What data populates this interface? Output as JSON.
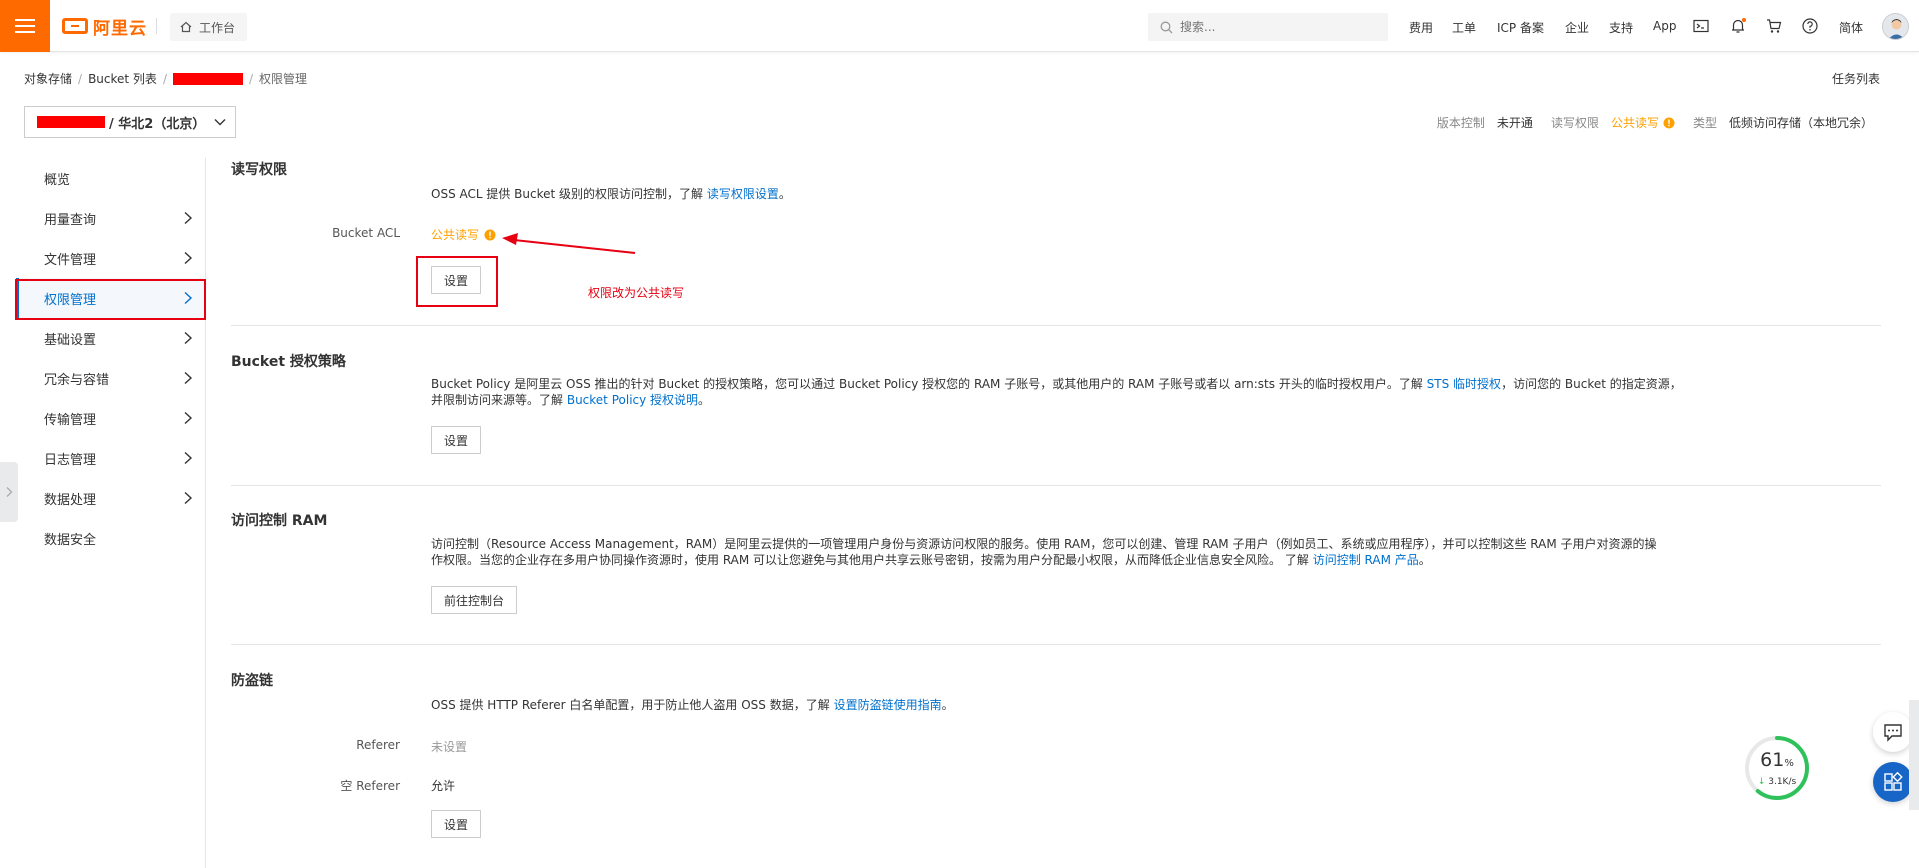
{
  "topbar": {
    "logo_text": "阿里云",
    "workbench_label": "工作台",
    "search_placeholder": "搜索...",
    "nav": [
      "费用",
      "工单",
      "ICP 备案",
      "企业",
      "支持",
      "App"
    ],
    "lang_label": "简体",
    "icons": [
      "terminal-icon",
      "bell-icon",
      "cart-icon",
      "help-icon"
    ]
  },
  "breadcrumb": {
    "items": [
      "对象存储",
      "Bucket 列表"
    ],
    "current": "权限管理"
  },
  "task_list_label": "任务列表",
  "bucket_selector": {
    "label": "/ 华北2（北京）"
  },
  "bucket_info": {
    "version_key": "版本控制",
    "version_value": "未开通",
    "acl_key": "读写权限",
    "acl_value": "公共读写",
    "type_key": "类型",
    "type_value": "低频访问存储（本地冗余）"
  },
  "sidebar": {
    "items": [
      {
        "label": "概览"
      },
      {
        "label": "用量查询"
      },
      {
        "label": "文件管理"
      },
      {
        "label": "权限管理"
      },
      {
        "label": "基础设置"
      },
      {
        "label": "冗余与容错"
      },
      {
        "label": "传输管理"
      },
      {
        "label": "日志管理"
      },
      {
        "label": "数据处理"
      },
      {
        "label": "数据安全"
      }
    ]
  },
  "sections": {
    "acl": {
      "title": "读写权限",
      "desc_prefix": "OSS ACL 提供 Bucket 级别的权限访问控制，了解",
      "desc_link": "读写权限设置",
      "desc_suffix": "。",
      "field_label": "Bucket ACL",
      "field_value": "公共读写",
      "button": "设置"
    },
    "policy": {
      "title": "Bucket 授权策略",
      "line1_prefix": "Bucket Policy 是阿里云 OSS 推出的针对 Bucket 的授权策略，您可以通过 Bucket Policy 授权您的 RAM 子账号，或其他用户的 RAM 子账号或者以 arn:sts 开头的临时授权用户。了解",
      "line1_link": "STS 临时授权",
      "line1_suffix": "，访问您的 Bucket 的指定资源，",
      "line2_prefix": "并限制访问来源等。了解",
      "line2_link": "Bucket Policy 授权说明",
      "line2_suffix": "。",
      "button": "设置"
    },
    "ram": {
      "title": "访问控制 RAM",
      "line1": "访问控制（Resource Access Management，RAM）是阿里云提供的一项管理用户身份与资源访问权限的服务。使用 RAM，您可以创建、管理 RAM 子用户（例如员工、系统或应用程序），并可以控制这些 RAM 子用户对资源的操",
      "line2_prefix": "作权限。当您的企业存在多用户协同操作资源时，使用 RAM 可以让您避免与其他用户共享云账号密钥，按需为用户分配最小权限，从而降低企业信息安全风险。 了解",
      "line2_link": "访问控制 RAM 产品",
      "line2_suffix": "。",
      "button": "前往控制台"
    },
    "referer": {
      "title": "防盗链",
      "desc_prefix": "OSS 提供 HTTP Referer 白名单配置，用于防止他人盗用 OSS 数据，了解",
      "desc_link": "设置防盗链使用指南",
      "desc_suffix": "。",
      "referer_label": "Referer",
      "referer_value": "未设置",
      "empty_label": "空 Referer",
      "empty_value": "允许",
      "button": "设置"
    }
  },
  "annotation": {
    "text": "权限改为公共读写"
  },
  "speed_widget": {
    "percent": "61",
    "percent_unit": "%",
    "rate": "3.1K/s",
    "progress": 0.61
  },
  "colors": {
    "brand": "#ff6a00",
    "link": "#0070cc",
    "warning": "#ffa000",
    "annotation": "#e60012"
  }
}
